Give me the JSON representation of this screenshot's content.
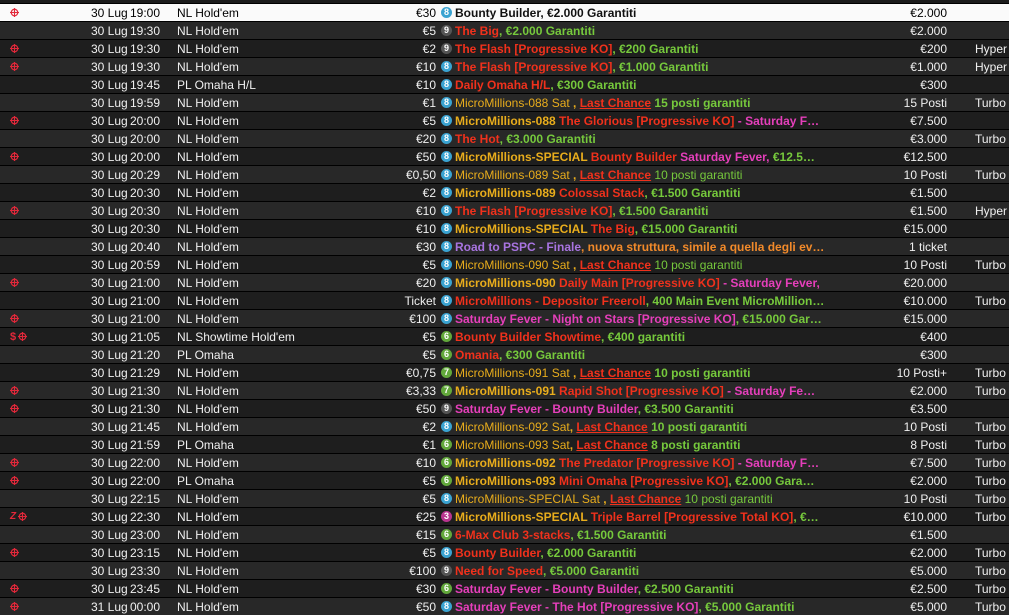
{
  "colors": {
    "row_even": "#1e1e1e",
    "row_odd": "#282828",
    "row_selected": "#fafafa",
    "accent_red": "#e2283a"
  },
  "badge_colors": {
    "8": "#3aa3d1",
    "9": "#555555",
    "6": "#62a83b",
    "7": "#62a83b",
    "3": "#b8348e"
  },
  "icon_colors": {
    "knockout": "#e2283a",
    "dollar": "#e2283a",
    "zed": "#e2283a"
  },
  "segment_colors": {
    "white": "#ffffff",
    "black": "#111111",
    "red": "#f0311c",
    "green": "#76c93c",
    "yellow": "#f0b51f",
    "pink": "#e63fbb",
    "orange": "#f28a2a",
    "purple": "#a874e0",
    "gold": "#e9ad1c",
    "olive": "#9dbb2f"
  },
  "tournaments": [
    {
      "icons": [
        "knockout"
      ],
      "date": "30 Lug",
      "time": "19:00",
      "game": "NL Hold'em",
      "buyin": "€30",
      "players": "8",
      "segments": [
        {
          "t": "Bounty Builder, €2.000 Garantiti",
          "c": "black"
        }
      ],
      "guarantee": "€2.000",
      "speed": "",
      "selected": true
    },
    {
      "icons": [],
      "date": "30 Lug",
      "time": "19:30",
      "game": "NL Hold'em",
      "buyin": "€5",
      "players": "9",
      "segments": [
        {
          "t": "The Big",
          "c": "red"
        },
        {
          "t": ", €2.000 Garantiti",
          "c": "green"
        }
      ],
      "guarantee": "€2.000",
      "speed": ""
    },
    {
      "icons": [
        "knockout"
      ],
      "date": "30 Lug",
      "time": "19:30",
      "game": "NL Hold'em",
      "buyin": "€2",
      "players": "9",
      "segments": [
        {
          "t": "The Flash [Progressive KO]",
          "c": "red"
        },
        {
          "t": ", €200 Garantiti",
          "c": "green"
        }
      ],
      "guarantee": "€200",
      "speed": "Hyper"
    },
    {
      "icons": [
        "knockout"
      ],
      "date": "30 Lug",
      "time": "19:30",
      "game": "NL Hold'em",
      "buyin": "€10",
      "players": "8",
      "segments": [
        {
          "t": "The Flash [Progressive KO]",
          "c": "red"
        },
        {
          "t": ", €1.000 Garantiti",
          "c": "green"
        }
      ],
      "guarantee": "€1.000",
      "speed": "Hyper"
    },
    {
      "icons": [],
      "date": "30 Lug",
      "time": "19:45",
      "game": "PL Omaha H/L",
      "buyin": "€10",
      "players": "8",
      "segments": [
        {
          "t": "Daily Omaha H/L",
          "c": "red"
        },
        {
          "t": ", €300 Garantiti",
          "c": "green"
        }
      ],
      "guarantee": "€300",
      "speed": ""
    },
    {
      "icons": [],
      "date": "30 Lug",
      "time": "19:59",
      "game": "NL Hold'em",
      "buyin": "€1",
      "players": "8",
      "segments": [
        {
          "t": "MicroMillions-088 Sat ",
          "c": "gold",
          "n": 1
        },
        {
          "t": ", ",
          "c": "gold"
        },
        {
          "t": "Last Chance",
          "c": "red",
          "u": 1
        },
        {
          "t": " 15 posti garantiti",
          "c": "green"
        }
      ],
      "guarantee": "15 Posti",
      "speed": "Turbo"
    },
    {
      "icons": [
        "knockout"
      ],
      "date": "30 Lug",
      "time": "20:00",
      "game": "NL Hold'em",
      "buyin": "€5",
      "players": "8",
      "segments": [
        {
          "t": "MicroMillions-088 ",
          "c": "gold"
        },
        {
          "t": "The Glorious [Progressive KO]",
          "c": "red"
        },
        {
          "t": " - Saturday F…",
          "c": "pink"
        }
      ],
      "guarantee": "€7.500",
      "speed": ""
    },
    {
      "icons": [],
      "date": "30 Lug",
      "time": "20:00",
      "game": "NL Hold'em",
      "buyin": "€20",
      "players": "8",
      "segments": [
        {
          "t": "The Hot",
          "c": "red"
        },
        {
          "t": ", €3.000 Garantiti",
          "c": "green"
        }
      ],
      "guarantee": "€3.000",
      "speed": "Turbo"
    },
    {
      "icons": [
        "knockout"
      ],
      "date": "30 Lug",
      "time": "20:00",
      "game": "NL Hold'em",
      "buyin": "€50",
      "players": "8",
      "segments": [
        {
          "t": "MicroMillions-SPECIAL ",
          "c": "gold"
        },
        {
          "t": "Bounty Builder ",
          "c": "red"
        },
        {
          "t": "Saturday Fever, ",
          "c": "pink"
        },
        {
          "t": " €12.5…",
          "c": "green"
        }
      ],
      "guarantee": "€12.500",
      "speed": ""
    },
    {
      "icons": [],
      "date": "30 Lug",
      "time": "20:29",
      "game": "NL Hold'em",
      "buyin": "€0,50",
      "players": "8",
      "segments": [
        {
          "t": "MicroMillions-089 Sat ",
          "c": "gold",
          "n": 1
        },
        {
          "t": ", ",
          "c": "gold"
        },
        {
          "t": "Last Chance",
          "c": "red",
          "u": 1
        },
        {
          "t": " 10 posti garantiti",
          "c": "green",
          "n": 1
        }
      ],
      "guarantee": "10 Posti",
      "speed": "Turbo"
    },
    {
      "icons": [],
      "date": "30 Lug",
      "time": "20:30",
      "game": "NL Hold'em",
      "buyin": "€2",
      "players": "8",
      "segments": [
        {
          "t": "MicroMillions-089 ",
          "c": "gold"
        },
        {
          "t": "Colossal Stack",
          "c": "red"
        },
        {
          "t": ", €1.500 Garantiti",
          "c": "green"
        }
      ],
      "guarantee": "€1.500",
      "speed": ""
    },
    {
      "icons": [
        "knockout"
      ],
      "date": "30 Lug",
      "time": "20:30",
      "game": "NL Hold'em",
      "buyin": "€10",
      "players": "8",
      "segments": [
        {
          "t": "The Flash [Progressive KO]",
          "c": "red"
        },
        {
          "t": ", €1.500 Garantiti",
          "c": "green"
        }
      ],
      "guarantee": "€1.500",
      "speed": "Hyper"
    },
    {
      "icons": [],
      "date": "30 Lug",
      "time": "20:30",
      "game": "NL Hold'em",
      "buyin": "€10",
      "players": "8",
      "segments": [
        {
          "t": "MicroMillions-SPECIAL ",
          "c": "gold"
        },
        {
          "t": "The Big",
          "c": "red"
        },
        {
          "t": ", €15.000 Garantiti",
          "c": "green"
        }
      ],
      "guarantee": "€15.000",
      "speed": ""
    },
    {
      "icons": [],
      "date": "30 Lug",
      "time": "20:40",
      "game": "NL Hold'em",
      "buyin": "€30",
      "players": "8",
      "segments": [
        {
          "t": "Road to PSPC - Finale",
          "c": "purple"
        },
        {
          "t": ", nuova struttura, simile a quella degli ev…",
          "c": "orange"
        }
      ],
      "guarantee": "1 ticket",
      "speed": ""
    },
    {
      "icons": [],
      "date": "30 Lug",
      "time": "20:59",
      "game": "NL Hold'em",
      "buyin": "€5",
      "players": "8",
      "segments": [
        {
          "t": "MicroMillions-090 Sat ",
          "c": "gold",
          "n": 1
        },
        {
          "t": ", ",
          "c": "gold"
        },
        {
          "t": "Last Chance",
          "c": "red",
          "u": 1
        },
        {
          "t": " 10 posti garantiti",
          "c": "green",
          "n": 1
        }
      ],
      "guarantee": "10 Posti",
      "speed": "Turbo"
    },
    {
      "icons": [
        "knockout"
      ],
      "date": "30 Lug",
      "time": "21:00",
      "game": "NL Hold'em",
      "buyin": "€20",
      "players": "8",
      "segments": [
        {
          "t": "MicroMillions-090 ",
          "c": "gold"
        },
        {
          "t": "Daily Main [Progressive KO]",
          "c": "red"
        },
        {
          "t": " - Saturday Fever,",
          "c": "pink"
        }
      ],
      "guarantee": "€20.000",
      "speed": ""
    },
    {
      "icons": [],
      "date": "30 Lug",
      "time": "21:00",
      "game": "NL Hold'em",
      "buyin": "Ticket",
      "players": "8",
      "segments": [
        {
          "t": "MicroMillions - Depositor Freeroll",
          "c": "red"
        },
        {
          "t": ", 400 Main Event MicroMillion…",
          "c": "green"
        }
      ],
      "guarantee": "€10.000",
      "speed": "Turbo"
    },
    {
      "icons": [
        "knockout"
      ],
      "date": "30 Lug",
      "time": "21:00",
      "game": "NL Hold'em",
      "buyin": "€100",
      "players": "8",
      "segments": [
        {
          "t": "Saturday Fever - Night on Stars [Progressive KO]",
          "c": "pink"
        },
        {
          "t": ", €15.000 Gar…",
          "c": "green"
        }
      ],
      "guarantee": "€15.000",
      "speed": ""
    },
    {
      "icons": [
        "dollar",
        "knockout"
      ],
      "date": "30 Lug",
      "time": "21:05",
      "game": "NL Showtime Hold'em",
      "buyin": "€5",
      "players": "6",
      "segments": [
        {
          "t": "Bounty Builder Showtime",
          "c": "red"
        },
        {
          "t": ", €400 garantiti",
          "c": "green"
        }
      ],
      "guarantee": "€400",
      "speed": ""
    },
    {
      "icons": [],
      "date": "30 Lug",
      "time": "21:20",
      "game": "PL Omaha",
      "buyin": "€5",
      "players": "6",
      "segments": [
        {
          "t": "Omania",
          "c": "red"
        },
        {
          "t": ", €300 Garantiti",
          "c": "green"
        }
      ],
      "guarantee": "€300",
      "speed": ""
    },
    {
      "icons": [],
      "date": "30 Lug",
      "time": "21:29",
      "game": "NL Hold'em",
      "buyin": "€0,75",
      "players": "7",
      "segments": [
        {
          "t": "MicroMillions-091 Sat ",
          "c": "gold",
          "n": 1
        },
        {
          "t": ", ",
          "c": "gold"
        },
        {
          "t": "Last Chance",
          "c": "red",
          "u": 1
        },
        {
          "t": " 10 posti garantiti",
          "c": "green"
        }
      ],
      "guarantee": "10 Posti+",
      "speed": "Turbo"
    },
    {
      "icons": [
        "knockout"
      ],
      "date": "30 Lug",
      "time": "21:30",
      "game": "NL Hold'em",
      "buyin": "€3,33",
      "players": "7",
      "segments": [
        {
          "t": "MicroMillions-091 ",
          "c": "gold"
        },
        {
          "t": "Rapid Shot [Progressive KO]",
          "c": "red"
        },
        {
          "t": " - Saturday Fe…",
          "c": "pink"
        }
      ],
      "guarantee": "€2.000",
      "speed": "Turbo"
    },
    {
      "icons": [
        "knockout"
      ],
      "date": "30 Lug",
      "time": "21:30",
      "game": "NL Hold'em",
      "buyin": "€50",
      "players": "9",
      "segments": [
        {
          "t": "Saturday Fever - Bounty Builder",
          "c": "pink"
        },
        {
          "t": ", €3.500 Garantiti",
          "c": "green"
        }
      ],
      "guarantee": "€3.500",
      "speed": ""
    },
    {
      "icons": [],
      "date": "30 Lug",
      "time": "21:45",
      "game": "NL Hold'em",
      "buyin": "€2",
      "players": "8",
      "segments": [
        {
          "t": "MicroMillions-092 Sat",
          "c": "gold",
          "n": 1
        },
        {
          "t": ", ",
          "c": "gold"
        },
        {
          "t": "Last Chance",
          "c": "red",
          "u": 1
        },
        {
          "t": " 10 posti garantiti",
          "c": "green"
        }
      ],
      "guarantee": "10 Posti",
      "speed": "Turbo"
    },
    {
      "icons": [],
      "date": "30 Lug",
      "time": "21:59",
      "game": "PL Omaha",
      "buyin": "€1",
      "players": "6",
      "segments": [
        {
          "t": "MicroMillions-093 Sat",
          "c": "gold",
          "n": 1
        },
        {
          "t": ", ",
          "c": "gold"
        },
        {
          "t": "Last Chance",
          "c": "red",
          "u": 1
        },
        {
          "t": " 8 posti garantiti",
          "c": "green"
        }
      ],
      "guarantee": "8 Posti",
      "speed": "Turbo"
    },
    {
      "icons": [
        "knockout"
      ],
      "date": "30 Lug",
      "time": "22:00",
      "game": "NL Hold'em",
      "buyin": "€10",
      "players": "6",
      "segments": [
        {
          "t": "MicroMillions-092 ",
          "c": "gold"
        },
        {
          "t": "The Predator [Progressive KO]",
          "c": "red"
        },
        {
          "t": " - Saturday F…",
          "c": "pink"
        }
      ],
      "guarantee": "€7.500",
      "speed": "Turbo"
    },
    {
      "icons": [
        "knockout"
      ],
      "date": "30 Lug",
      "time": "22:00",
      "game": "PL Omaha",
      "buyin": "€5",
      "players": "6",
      "segments": [
        {
          "t": "MicroMillions-093 ",
          "c": "gold"
        },
        {
          "t": "Mini Omaha [Progressive KO]",
          "c": "red"
        },
        {
          "t": ", €2.000 Gara…",
          "c": "green"
        }
      ],
      "guarantee": "€2.000",
      "speed": "Turbo"
    },
    {
      "icons": [],
      "date": "30 Lug",
      "time": "22:15",
      "game": "NL Hold'em",
      "buyin": "€5",
      "players": "8",
      "segments": [
        {
          "t": "MicroMillions-SPECIAL Sat ",
          "c": "gold",
          "n": 1
        },
        {
          "t": ", ",
          "c": "gold"
        },
        {
          "t": "Last Chance",
          "c": "red",
          "u": 1
        },
        {
          "t": " 10 posti garantiti",
          "c": "green",
          "n": 1
        }
      ],
      "guarantee": "10 Posti",
      "speed": "Turbo"
    },
    {
      "icons": [
        "zed",
        "knockout"
      ],
      "date": "30 Lug",
      "time": "22:30",
      "game": "NL Hold'em",
      "buyin": "€25",
      "players": "3",
      "segments": [
        {
          "t": "MicroMillions-SPECIAL ",
          "c": "gold"
        },
        {
          "t": "Triple Barrel [Progressive Total KO]",
          "c": "red"
        },
        {
          "t": ", €…",
          "c": "green"
        }
      ],
      "guarantee": "€10.000",
      "speed": "Turbo"
    },
    {
      "icons": [],
      "date": "30 Lug",
      "time": "23:00",
      "game": "NL Hold'em",
      "buyin": "€15",
      "players": "6",
      "segments": [
        {
          "t": "6-Max Club 3-stacks",
          "c": "red"
        },
        {
          "t": ", €1.500 Garantiti",
          "c": "green"
        }
      ],
      "guarantee": "€1.500",
      "speed": ""
    },
    {
      "icons": [
        "knockout"
      ],
      "date": "30 Lug",
      "time": "23:15",
      "game": "NL Hold'em",
      "buyin": "€5",
      "players": "8",
      "segments": [
        {
          "t": "Bounty Builder",
          "c": "red"
        },
        {
          "t": ", €2.000 Garantiti",
          "c": "green"
        }
      ],
      "guarantee": "€2.000",
      "speed": "Turbo"
    },
    {
      "icons": [],
      "date": "30 Lug",
      "time": "23:30",
      "game": "NL Hold'em",
      "buyin": "€100",
      "players": "9",
      "segments": [
        {
          "t": "Need for Speed",
          "c": "red"
        },
        {
          "t": ", €5.000 Garantiti",
          "c": "green"
        }
      ],
      "guarantee": "€5.000",
      "speed": "Turbo"
    },
    {
      "icons": [
        "knockout"
      ],
      "date": "30 Lug",
      "time": "23:45",
      "game": "NL Hold'em",
      "buyin": "€30",
      "players": "6",
      "segments": [
        {
          "t": "Saturday Fever - Bounty Builder",
          "c": "pink"
        },
        {
          "t": ", €2.500 Garantiti",
          "c": "green"
        }
      ],
      "guarantee": "€2.500",
      "speed": "Turbo"
    },
    {
      "icons": [
        "knockout"
      ],
      "date": "31 Lug",
      "time": "00:00",
      "game": "NL Hold'em",
      "buyin": "€50",
      "players": "8",
      "segments": [
        {
          "t": "Saturday Fever - The Hot [Progressive KO]",
          "c": "pink"
        },
        {
          "t": ", €5.000 Garantiti",
          "c": "green"
        }
      ],
      "guarantee": "€5.000",
      "speed": "Turbo"
    }
  ]
}
